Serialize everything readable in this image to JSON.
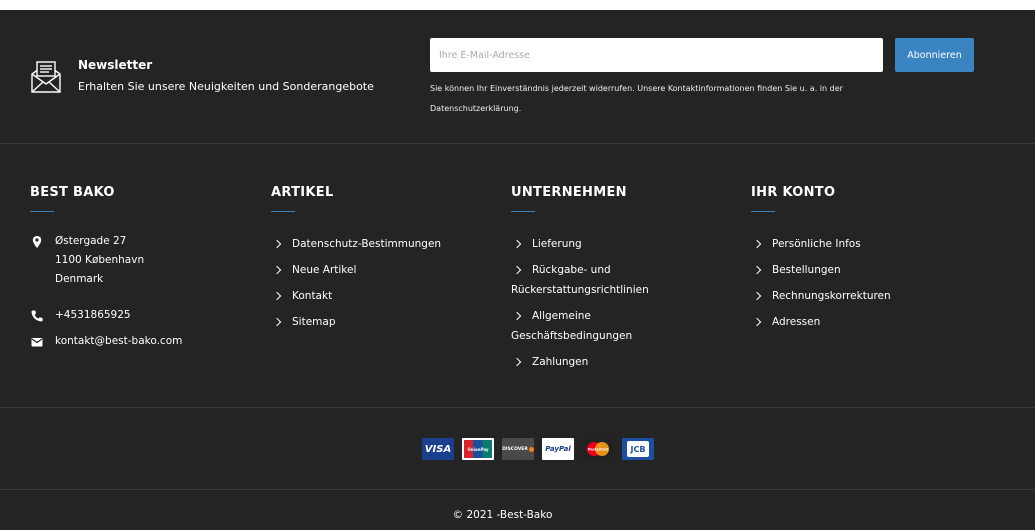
{
  "newsletter": {
    "title": "Newsletter",
    "subtitle": "Erhalten Sie unsere Neuigkeiten und Sonderangebote",
    "placeholder": "Ihre E-Mail-Adresse",
    "button": "Abonnieren",
    "note_line1": "Sie können Ihr Einverständnis jederzeit widerrufen. Unsere Kontaktinformationen finden Sie u. a. in der",
    "note_line2": "Datenschutzerklärung.",
    "icon": "newsletter-envelope-icon"
  },
  "company": {
    "heading": "BEST BAKO",
    "address_line1": "Østergade 27",
    "address_line2": "1100 København",
    "address_line3": "Denmark",
    "phone": "+4531865925",
    "email": "kontakt@best-bako.com"
  },
  "articles": {
    "heading": "ARTIKEL",
    "links": [
      "Datenschutz-Bestimmungen",
      "Neue Artikel",
      "Kontakt",
      "Sitemap"
    ]
  },
  "business": {
    "heading": "UNTERNEHMEN",
    "links": [
      {
        "line1": "Lieferung",
        "line2": ""
      },
      {
        "line1": "Rückgabe- und",
        "line2": "Rückerstattungsrichtlinien"
      },
      {
        "line1": "Allgemeine",
        "line2": "Geschäftsbedingungen"
      },
      {
        "line1": "Zahlungen",
        "line2": ""
      }
    ]
  },
  "account": {
    "heading": "IHR KONTO",
    "links": [
      "Persönliche Infos",
      "Bestellungen",
      "Rechnungskorrekturen",
      "Adressen"
    ]
  },
  "payments": {
    "visa": "VISA",
    "unionpay": "UnionPay",
    "discover": "DISCOVER",
    "paypal": "PayPal",
    "mastercard": "MasterCard",
    "jcb": "JCB"
  },
  "colors": {
    "background": "#242424",
    "accent": "#3a84c1"
  },
  "copyright": "© 2021 -Best-Bako"
}
